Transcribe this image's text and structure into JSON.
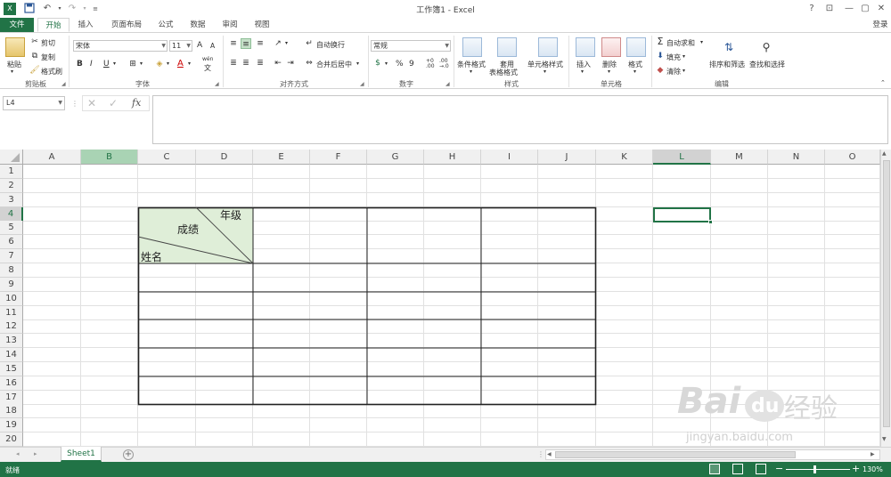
{
  "app": {
    "window_title": "工作簿1 - Excel",
    "help_label": "?",
    "signin_label": "登录"
  },
  "tabs": [
    {
      "label": "文件"
    },
    {
      "label": "开始"
    },
    {
      "label": "插入"
    },
    {
      "label": "页面布局"
    },
    {
      "label": "公式"
    },
    {
      "label": "数据"
    },
    {
      "label": "审阅"
    },
    {
      "label": "视图"
    }
  ],
  "ribbon": {
    "clipboard": {
      "paste": "粘贴",
      "cut": "剪切",
      "copy": "复制",
      "format_painter": "格式刷",
      "group": "剪贴板"
    },
    "font": {
      "name": "宋体",
      "size": "11",
      "bold": "B",
      "italic": "I",
      "underline": "U",
      "grow": "A",
      "shrink": "A",
      "wen": "wén",
      "wen2": "文",
      "group": "字体"
    },
    "alignment": {
      "wrap": "自动换行",
      "merge": "合并后居中",
      "group": "对齐方式"
    },
    "number": {
      "format": "常规",
      "percent": "%",
      "comma": "9",
      "inc": "+0\n.00",
      "dec": ".00",
      "group": "数字"
    },
    "styles": {
      "conditional": "条件格式",
      "table": "套用",
      "table2": "表格格式",
      "cell_styles": "单元格样式",
      "group": "样式"
    },
    "cells": {
      "insert": "插入",
      "delete": "删除",
      "format": "格式",
      "group": "单元格"
    },
    "editing": {
      "autosum": "自动求和",
      "fill": "填充",
      "clear": "清除",
      "sort": "排序和筛选",
      "find": "查找和选择",
      "group": "编辑"
    }
  },
  "formula_bar": {
    "name_box": "L4",
    "fx": "fx",
    "value": ""
  },
  "sheet": {
    "columns": [
      "A",
      "B",
      "C",
      "D",
      "E",
      "F",
      "G",
      "H",
      "I",
      "J",
      "K",
      "L",
      "M",
      "N",
      "O"
    ],
    "rows": [
      "1",
      "2",
      "3",
      "4",
      "5",
      "6",
      "7",
      "8",
      "9",
      "10",
      "11",
      "12",
      "13",
      "14",
      "15",
      "16",
      "17",
      "18",
      "19",
      "20"
    ],
    "selected_cell": "L4",
    "header_cell": {
      "top_right": "年级",
      "middle": "成绩",
      "bottom_left": "姓名"
    },
    "header_fill": "#dfeed8"
  },
  "sheet_tabs": [
    {
      "label": "Sheet1"
    }
  ],
  "status": {
    "ready": "就绪",
    "zoom": "130%",
    "zoom_minus": "−",
    "zoom_plus": "+"
  },
  "colors": {
    "accent": "#217346"
  },
  "watermark": {
    "brand": "Bai",
    "logo": "du",
    "cn": "经验",
    "url": "jingyan.baidu.com"
  }
}
